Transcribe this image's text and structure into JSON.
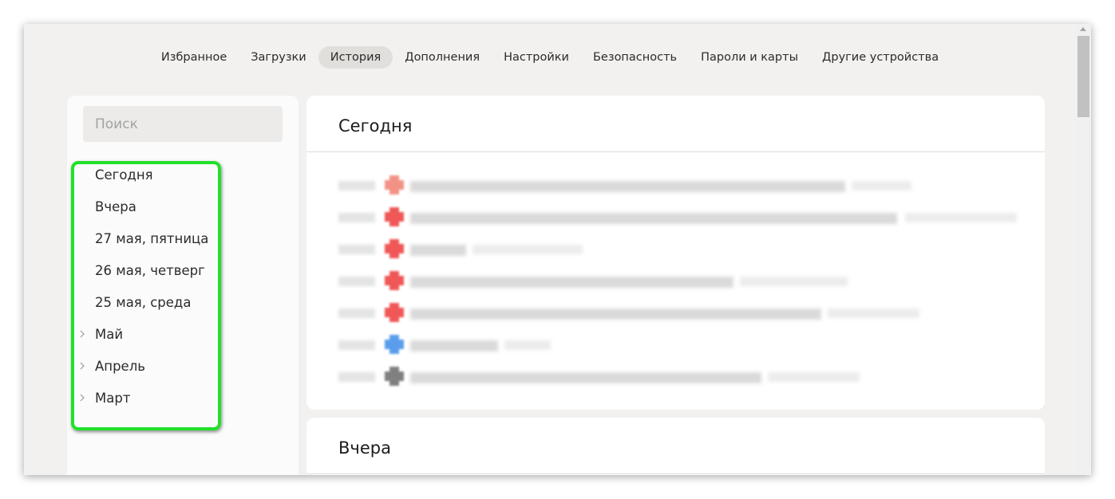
{
  "nav": {
    "tabs": [
      {
        "label": "Избранное",
        "active": false
      },
      {
        "label": "Загрузки",
        "active": false
      },
      {
        "label": "История",
        "active": true
      },
      {
        "label": "Дополнения",
        "active": false
      },
      {
        "label": "Настройки",
        "active": false
      },
      {
        "label": "Безопасность",
        "active": false
      },
      {
        "label": "Пароли и карты",
        "active": false
      },
      {
        "label": "Другие устройства",
        "active": false
      }
    ]
  },
  "sidebar": {
    "search_placeholder": "Поиск",
    "dates": [
      {
        "label": "Сегодня",
        "expandable": false
      },
      {
        "label": "Вчера",
        "expandable": false
      },
      {
        "label": "27 мая, пятница",
        "expandable": false
      },
      {
        "label": "26 мая, четверг",
        "expandable": false
      },
      {
        "label": "25 мая, среда",
        "expandable": false
      },
      {
        "label": "Май",
        "expandable": true
      },
      {
        "label": "Апрель",
        "expandable": true
      },
      {
        "label": "Март",
        "expandable": true
      }
    ],
    "highlight_color": "#22e02a"
  },
  "main": {
    "sections": [
      {
        "title": "Сегодня"
      },
      {
        "title": "Вчера"
      }
    ],
    "today_entries": [
      {
        "favicon_color": "#f08070",
        "obscured": true
      },
      {
        "favicon_color": "#ee3a3a",
        "obscured": true
      },
      {
        "favicon_color": "#ee3a3a",
        "obscured": true
      },
      {
        "favicon_color": "#ee3a3a",
        "obscured": true
      },
      {
        "favicon_color": "#ee3a3a",
        "obscured": true
      },
      {
        "favicon_color": "#3d8de8",
        "obscured": true
      },
      {
        "favicon_color": "#6a6a6a",
        "obscured": true
      }
    ]
  },
  "colors": {
    "window_bg": "#f2f1ef",
    "active_tab_bg": "#e1dfdc",
    "card_bg": "#ffffff"
  }
}
